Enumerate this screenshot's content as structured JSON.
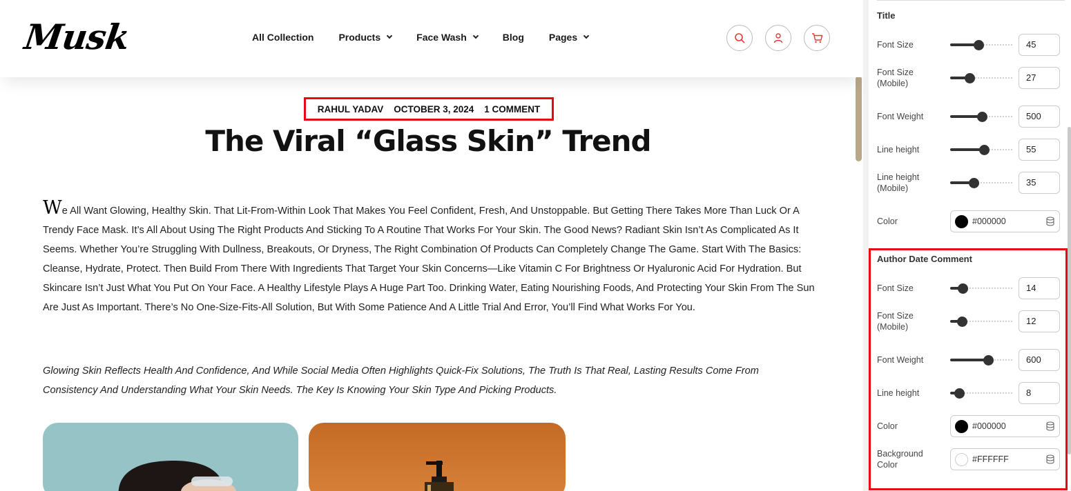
{
  "header": {
    "logo": "Musk",
    "nav": [
      {
        "label": "All Collection",
        "dropdown": false
      },
      {
        "label": "Products",
        "dropdown": true
      },
      {
        "label": "Face Wash",
        "dropdown": true
      },
      {
        "label": "Blog",
        "dropdown": false
      },
      {
        "label": "Pages",
        "dropdown": true
      }
    ],
    "icons": [
      "search-icon",
      "user-icon",
      "cart-icon"
    ],
    "icon_color": "#e53935"
  },
  "post": {
    "author": "RAHUL YADAV",
    "date": "OCTOBER 3, 2024",
    "comments": "1 COMMENT",
    "title": "The Viral “Glass Skin” Trend",
    "dropcap": "W",
    "body": "e All Want Glowing, Healthy Skin. That Lit-From-Within Look That Makes You Feel Confident, Fresh, And Unstoppable. But Getting There Takes More Than Luck Or A Trendy Face Mask. It’s All About Using The Right Products And Sticking To A Routine That Works For Your Skin. The Good News? Radiant Skin Isn’t As Complicated As It Seems. Whether You’re Struggling With Dullness, Breakouts, Or Dryness, The Right Combination Of Products Can Completely Change The Game. Start With The Basics: Cleanse, Hydrate, Protect. Then Build From There With Ingredients That Target Your Skin Concerns—Like Vitamin C For Brightness Or Hyaluronic Acid For Hydration. But Skincare Isn’t Just What You Put On Your Face. A Healthy Lifestyle Plays A Huge Part Too. Drinking Water, Eating Nourishing Foods, And Protecting Your Skin From The Sun Are Just As Important. There’s No One-Size-Fits-All Solution, But With Some Patience And A Little Trial And Error, You’ll Find What Works For You.",
    "italic": "Glowing Skin Reflects Health And Confidence, And While Social Media Often Highlights Quick-Fix Solutions, The Truth Is That Real, Lasting Results Come From Consistency And Understanding What Your Skin Needs. The Key Is Knowing Your Skin Type And Picking Products."
  },
  "panel": {
    "title_section": {
      "heading": "Title",
      "font_size": {
        "label": "Font Size",
        "value": "45",
        "level": 0.45
      },
      "font_size_mobile": {
        "label": "Font Size (Mobile)",
        "value": "27",
        "level": 0.3
      },
      "font_weight": {
        "label": "Font Weight",
        "value": "500",
        "level": 0.5
      },
      "line_height": {
        "label": "Line height",
        "value": "55",
        "level": 0.53
      },
      "line_height_mobile": {
        "label": "Line height (Mobile)",
        "value": "35",
        "level": 0.37
      },
      "color": {
        "label": "Color",
        "value": "#000000",
        "swatch": "#000000"
      }
    },
    "adc_section": {
      "heading": "Author Date Comment",
      "font_size": {
        "label": "Font Size",
        "value": "14",
        "level": 0.2
      },
      "font_size_mobile": {
        "label": "Font Size (Mobile)",
        "value": "12",
        "level": 0.18
      },
      "font_weight": {
        "label": "Font Weight",
        "value": "600",
        "level": 0.6
      },
      "line_height": {
        "label": "Line height",
        "value": "8",
        "level": 0.14
      },
      "color": {
        "label": "Color",
        "value": "#000000",
        "swatch": "#000000"
      },
      "bg_color": {
        "label": "Background Color",
        "value": "#FFFFFF",
        "swatch": "#FFFFFF"
      }
    }
  },
  "highlight_color": "#e50914"
}
